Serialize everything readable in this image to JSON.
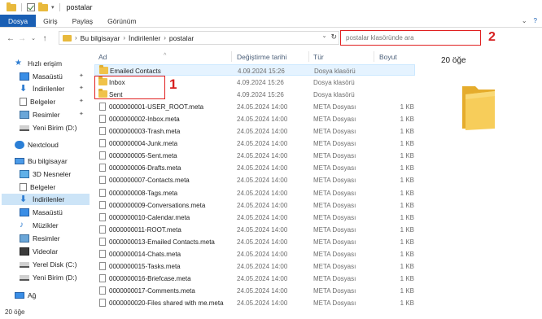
{
  "window": {
    "title": "postalar"
  },
  "ribbon": {
    "tabs": [
      "Dosya",
      "Giriş",
      "Paylaş",
      "Görünüm"
    ]
  },
  "address": {
    "path": [
      "Bu bilgisayar",
      "İndirilenler",
      "postalar"
    ]
  },
  "search": {
    "placeholder": "postalar klasöründe ara"
  },
  "annotations": {
    "label_1": "1",
    "label_2": "2"
  },
  "nav": {
    "items": [
      {
        "label": "Hızlı erişim",
        "icon": "star-icon"
      },
      {
        "label": "Masaüstü",
        "icon": "desktop-icon",
        "pinned": true
      },
      {
        "label": "İndirilenler",
        "icon": "download-icon",
        "pinned": true
      },
      {
        "label": "Belgeler",
        "icon": "documents-icon",
        "pinned": true
      },
      {
        "label": "Resimler",
        "icon": "pictures-icon",
        "pinned": true
      },
      {
        "label": "Yeni Birim (D:)",
        "icon": "drive-icon"
      },
      {
        "label": "Nextcloud",
        "icon": "cloud-icon"
      },
      {
        "label": "Bu bilgisayar",
        "icon": "computer-icon"
      },
      {
        "label": "3D Nesneler",
        "icon": "3d-objects-icon"
      },
      {
        "label": "Belgeler",
        "icon": "documents-icon"
      },
      {
        "label": "İndirilenler",
        "icon": "download-icon",
        "selected": true
      },
      {
        "label": "Masaüstü",
        "icon": "desktop-icon"
      },
      {
        "label": "Müzikler",
        "icon": "music-icon"
      },
      {
        "label": "Resimler",
        "icon": "pictures-icon"
      },
      {
        "label": "Videolar",
        "icon": "video-icon"
      },
      {
        "label": "Yerel Disk (C:)",
        "icon": "drive-icon"
      },
      {
        "label": "Yeni Birim (D:)",
        "icon": "drive-icon"
      },
      {
        "label": "Ağ",
        "icon": "network-icon"
      }
    ]
  },
  "filelist": {
    "columns": {
      "name": "Ad",
      "date": "Değiştirme tarihi",
      "type": "Tür",
      "size": "Boyut"
    },
    "rows": [
      {
        "name": "Emailed Contacts",
        "date": "4.09.2024 15:26",
        "type": "Dosya klasörü",
        "size": "",
        "kind": "folder"
      },
      {
        "name": "Inbox",
        "date": "4.09.2024 15:26",
        "type": "Dosya klasörü",
        "size": "",
        "kind": "folder"
      },
      {
        "name": "Sent",
        "date": "4.09.2024 15:26",
        "type": "Dosya klasörü",
        "size": "",
        "kind": "folder"
      },
      {
        "name": "0000000001-USER_ROOT.meta",
        "date": "24.05.2024 14:00",
        "type": "META Dosyası",
        "size": "1 KB",
        "kind": "file"
      },
      {
        "name": "0000000002-Inbox.meta",
        "date": "24.05.2024 14:00",
        "type": "META Dosyası",
        "size": "1 KB",
        "kind": "file"
      },
      {
        "name": "0000000003-Trash.meta",
        "date": "24.05.2024 14:00",
        "type": "META Dosyası",
        "size": "1 KB",
        "kind": "file"
      },
      {
        "name": "0000000004-Junk.meta",
        "date": "24.05.2024 14:00",
        "type": "META Dosyası",
        "size": "1 KB",
        "kind": "file"
      },
      {
        "name": "0000000005-Sent.meta",
        "date": "24.05.2024 14:00",
        "type": "META Dosyası",
        "size": "1 KB",
        "kind": "file"
      },
      {
        "name": "0000000006-Drafts.meta",
        "date": "24.05.2024 14:00",
        "type": "META Dosyası",
        "size": "1 KB",
        "kind": "file"
      },
      {
        "name": "0000000007-Contacts.meta",
        "date": "24.05.2024 14:00",
        "type": "META Dosyası",
        "size": "1 KB",
        "kind": "file"
      },
      {
        "name": "0000000008-Tags.meta",
        "date": "24.05.2024 14:00",
        "type": "META Dosyası",
        "size": "1 KB",
        "kind": "file"
      },
      {
        "name": "0000000009-Conversations.meta",
        "date": "24.05.2024 14:00",
        "type": "META Dosyası",
        "size": "1 KB",
        "kind": "file"
      },
      {
        "name": "0000000010-Calendar.meta",
        "date": "24.05.2024 14:00",
        "type": "META Dosyası",
        "size": "1 KB",
        "kind": "file"
      },
      {
        "name": "0000000011-ROOT.meta",
        "date": "24.05.2024 14:00",
        "type": "META Dosyası",
        "size": "1 KB",
        "kind": "file"
      },
      {
        "name": "0000000013-Emailed Contacts.meta",
        "date": "24.05.2024 14:00",
        "type": "META Dosyası",
        "size": "1 KB",
        "kind": "file"
      },
      {
        "name": "0000000014-Chats.meta",
        "date": "24.05.2024 14:00",
        "type": "META Dosyası",
        "size": "1 KB",
        "kind": "file"
      },
      {
        "name": "0000000015-Tasks.meta",
        "date": "24.05.2024 14:00",
        "type": "META Dosyası",
        "size": "1 KB",
        "kind": "file"
      },
      {
        "name": "0000000016-Briefcase.meta",
        "date": "24.05.2024 14:00",
        "type": "META Dosyası",
        "size": "1 KB",
        "kind": "file"
      },
      {
        "name": "0000000017-Comments.meta",
        "date": "24.05.2024 14:00",
        "type": "META Dosyası",
        "size": "1 KB",
        "kind": "file"
      },
      {
        "name": "0000000020-Files shared with me.meta",
        "date": "24.05.2024 14:00",
        "type": "META Dosyası",
        "size": "1 KB",
        "kind": "file"
      }
    ]
  },
  "preview": {
    "count": "20 öğe"
  },
  "status": {
    "count": "20 öğe"
  }
}
